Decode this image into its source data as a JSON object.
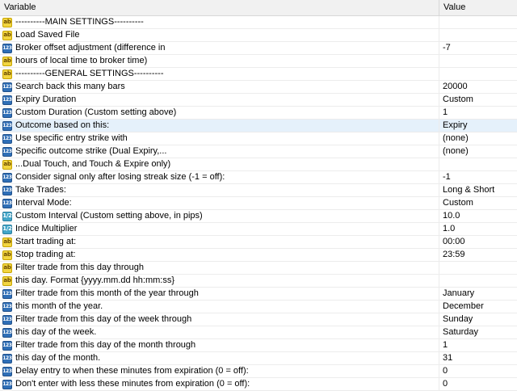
{
  "header": {
    "variable": "Variable",
    "value": "Value"
  },
  "rows": [
    {
      "icon": "ab",
      "label": "----------MAIN SETTINGS----------",
      "value": ""
    },
    {
      "icon": "ab",
      "label": "Load Saved File",
      "value": ""
    },
    {
      "icon": "123",
      "label": "Broker offset adjustment (difference in",
      "value": "-7"
    },
    {
      "icon": "ab",
      "label": "hours of local time to broker time)",
      "value": ""
    },
    {
      "icon": "ab",
      "label": "----------GENERAL SETTINGS----------",
      "value": ""
    },
    {
      "icon": "123",
      "label": "Search back this many bars",
      "value": "20000"
    },
    {
      "icon": "123",
      "label": "Expiry Duration",
      "value": "Custom"
    },
    {
      "icon": "123",
      "label": "Custom Duration (Custom setting above)",
      "value": "1"
    },
    {
      "icon": "123",
      "label": "Outcome based on this:",
      "value": "Expiry"
    },
    {
      "icon": "123",
      "label": "Use specific entry strike with",
      "value": "(none)"
    },
    {
      "icon": "123",
      "label": "Specific outcome strike (Dual Expiry,...",
      "value": "(none)"
    },
    {
      "icon": "ab",
      "label": "...Dual Touch, and Touch & Expire only)",
      "value": ""
    },
    {
      "icon": "123",
      "label": "Consider signal only after losing streak size (-1 = off):",
      "value": "-1"
    },
    {
      "icon": "123",
      "label": "Take Trades:",
      "value": "Long & Short"
    },
    {
      "icon": "123",
      "label": "Interval Mode:",
      "value": "Custom"
    },
    {
      "icon": "1/2",
      "label": "Custom Interval (Custom setting above, in pips)",
      "value": "10.0"
    },
    {
      "icon": "1/2",
      "label": "Indice Multiplier",
      "value": "1.0"
    },
    {
      "icon": "ab",
      "label": "Start trading at:",
      "value": "00:00"
    },
    {
      "icon": "ab",
      "label": "Stop trading at:",
      "value": "23:59"
    },
    {
      "icon": "ab",
      "label": "Filter trade from this day through",
      "value": ""
    },
    {
      "icon": "ab",
      "label": "this day. Format {yyyy.mm.dd hh:mm:ss}",
      "value": ""
    },
    {
      "icon": "123",
      "label": "Filter trade from this month of the year through",
      "value": "January"
    },
    {
      "icon": "123",
      "label": "this month of the year.",
      "value": "December"
    },
    {
      "icon": "123",
      "label": "Filter trade from this day of the week through",
      "value": "Sunday"
    },
    {
      "icon": "123",
      "label": "this day of the week.",
      "value": "Saturday"
    },
    {
      "icon": "123",
      "label": "Filter trade from this day of the month through",
      "value": "1"
    },
    {
      "icon": "123",
      "label": "this day of the month.",
      "value": "31"
    },
    {
      "icon": "123",
      "label": "Delay entry to when these minutes from expiration (0 = off):",
      "value": "0"
    },
    {
      "icon": "123",
      "label": "Don't enter with less these minutes from expiration (0 = off):",
      "value": "0"
    }
  ],
  "selected_row": 8
}
